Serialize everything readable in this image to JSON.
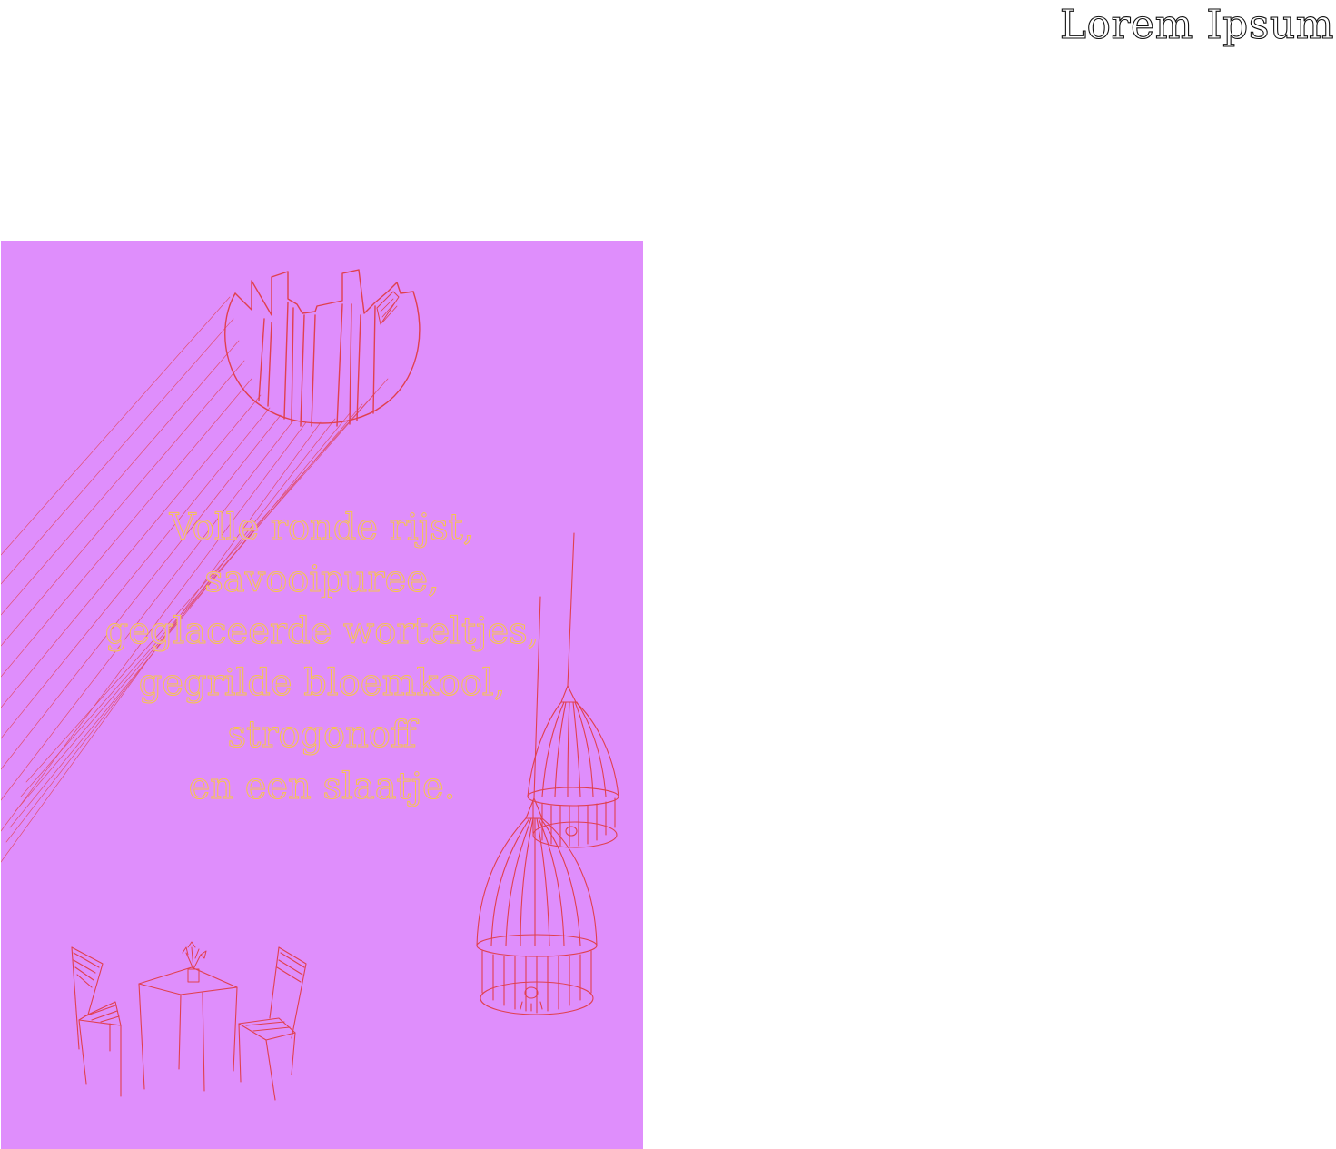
{
  "header": {
    "title": "Lorem Ipsum"
  },
  "poster": {
    "background_color": "#df8efc",
    "text_color": "#f7c54a",
    "line_color": "#e0404e",
    "menu_lines": [
      "Volle ronde rijst,",
      "savooipuree,",
      "geglaceerde worteltjes,",
      "gegrilde bloemkool,",
      "strogonoff",
      "en een slaatje."
    ],
    "illustrations": [
      "skylight-icon",
      "light-rays-icon",
      "pendant-lamp-icon",
      "cafe-table-icon",
      "cafe-chair-icon",
      "flower-vase-icon"
    ]
  }
}
